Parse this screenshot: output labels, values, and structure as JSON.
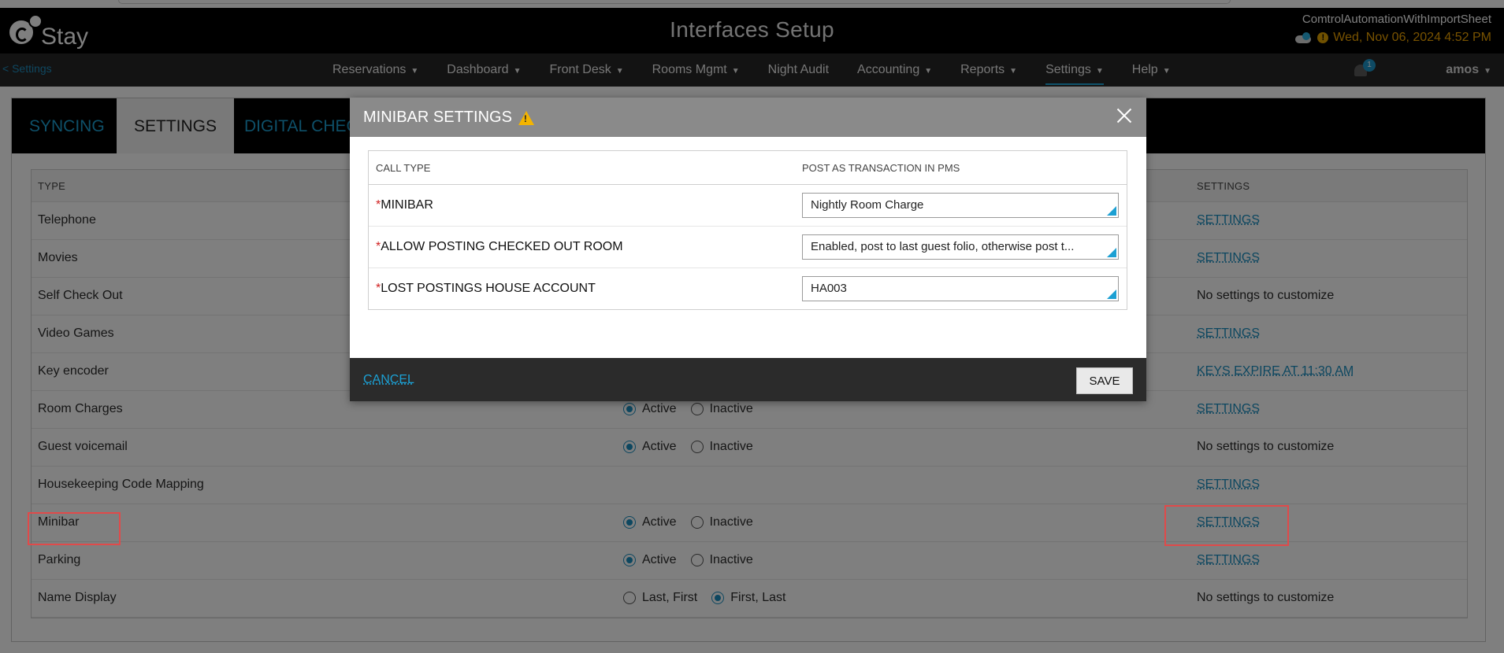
{
  "header": {
    "logo_text": "Stay",
    "title": "Interfaces Setup",
    "account_name": "ComtrolAutomationWithImportSheet",
    "datetime": "Wed, Nov 06, 2024 4:52 PM",
    "weather_icon": "cloud-moon-icon",
    "alert_icon": "alert-icon",
    "alert_symbol": "!"
  },
  "nav": {
    "back_link": "< Settings",
    "items": [
      {
        "label": "Reservations",
        "dropdown": true
      },
      {
        "label": "Dashboard",
        "dropdown": true
      },
      {
        "label": "Front Desk",
        "dropdown": true
      },
      {
        "label": "Rooms Mgmt",
        "dropdown": true
      },
      {
        "label": "Night Audit",
        "dropdown": false
      },
      {
        "label": "Accounting",
        "dropdown": true
      },
      {
        "label": "Reports",
        "dropdown": true
      },
      {
        "label": "Settings",
        "dropdown": true,
        "active": true
      },
      {
        "label": "Help",
        "dropdown": true
      }
    ],
    "caret": "▼",
    "notification_count": "1",
    "user": "amos"
  },
  "tabs": [
    {
      "label": "SYNCING"
    },
    {
      "label": "SETTINGS",
      "selected": true
    },
    {
      "label": "DIGITAL CHEC"
    }
  ],
  "grid": {
    "headers": {
      "type": "TYPE",
      "settings": "SETTINGS"
    },
    "rows": [
      {
        "type": "Telephone",
        "status": null,
        "settings": "SETTINGS",
        "link": true
      },
      {
        "type": "Movies",
        "status": null,
        "settings": "SETTINGS",
        "link": true
      },
      {
        "type": "Self Check Out",
        "status": null,
        "settings": "No settings to customize",
        "link": false
      },
      {
        "type": "Video Games",
        "status": null,
        "settings": "SETTINGS",
        "link": true
      },
      {
        "type": "Key encoder",
        "status": null,
        "settings": "KEYS EXPIRE AT 11:30 AM",
        "link": true
      },
      {
        "type": "Room Charges",
        "options": [
          "Active",
          "Inactive"
        ],
        "selected": 0,
        "settings": "SETTINGS",
        "link": true
      },
      {
        "type": "Guest voicemail",
        "options": [
          "Active",
          "Inactive"
        ],
        "selected": 0,
        "settings": "No settings to customize",
        "link": false
      },
      {
        "type": "Housekeeping Code Mapping",
        "options": [],
        "selected": null,
        "settings": "SETTINGS",
        "link": true
      },
      {
        "type": "Minibar",
        "options": [
          "Active",
          "Inactive"
        ],
        "selected": 0,
        "settings": "SETTINGS",
        "link": true
      },
      {
        "type": "Parking",
        "options": [
          "Active",
          "Inactive"
        ],
        "selected": 0,
        "settings": "SETTINGS",
        "link": true
      },
      {
        "type": "Name Display",
        "options": [
          "Last, First",
          "First, Last"
        ],
        "selected": 1,
        "settings": "No settings to customize",
        "link": false
      }
    ]
  },
  "modal": {
    "title": "MINIBAR SETTINGS",
    "warning_icon": "warning-icon",
    "headers": {
      "call_type": "CALL TYPE",
      "post_as": "POST AS TRANSACTION IN PMS"
    },
    "rows": [
      {
        "required": "*",
        "label": "MINIBAR",
        "value": "Nightly Room Charge"
      },
      {
        "required": "*",
        "label": "ALLOW POSTING CHECKED OUT ROOM",
        "value": "Enabled, post to last guest folio, otherwise post t..."
      },
      {
        "required": "*",
        "label": "LOST POSTINGS HOUSE ACCOUNT",
        "value": "HA003"
      }
    ],
    "cancel_label": "CANCEL",
    "save_label": "SAVE"
  },
  "colors": {
    "accent": "#1ca0d3",
    "highlight": "#e04a4a",
    "date_text": "#f0a500"
  }
}
